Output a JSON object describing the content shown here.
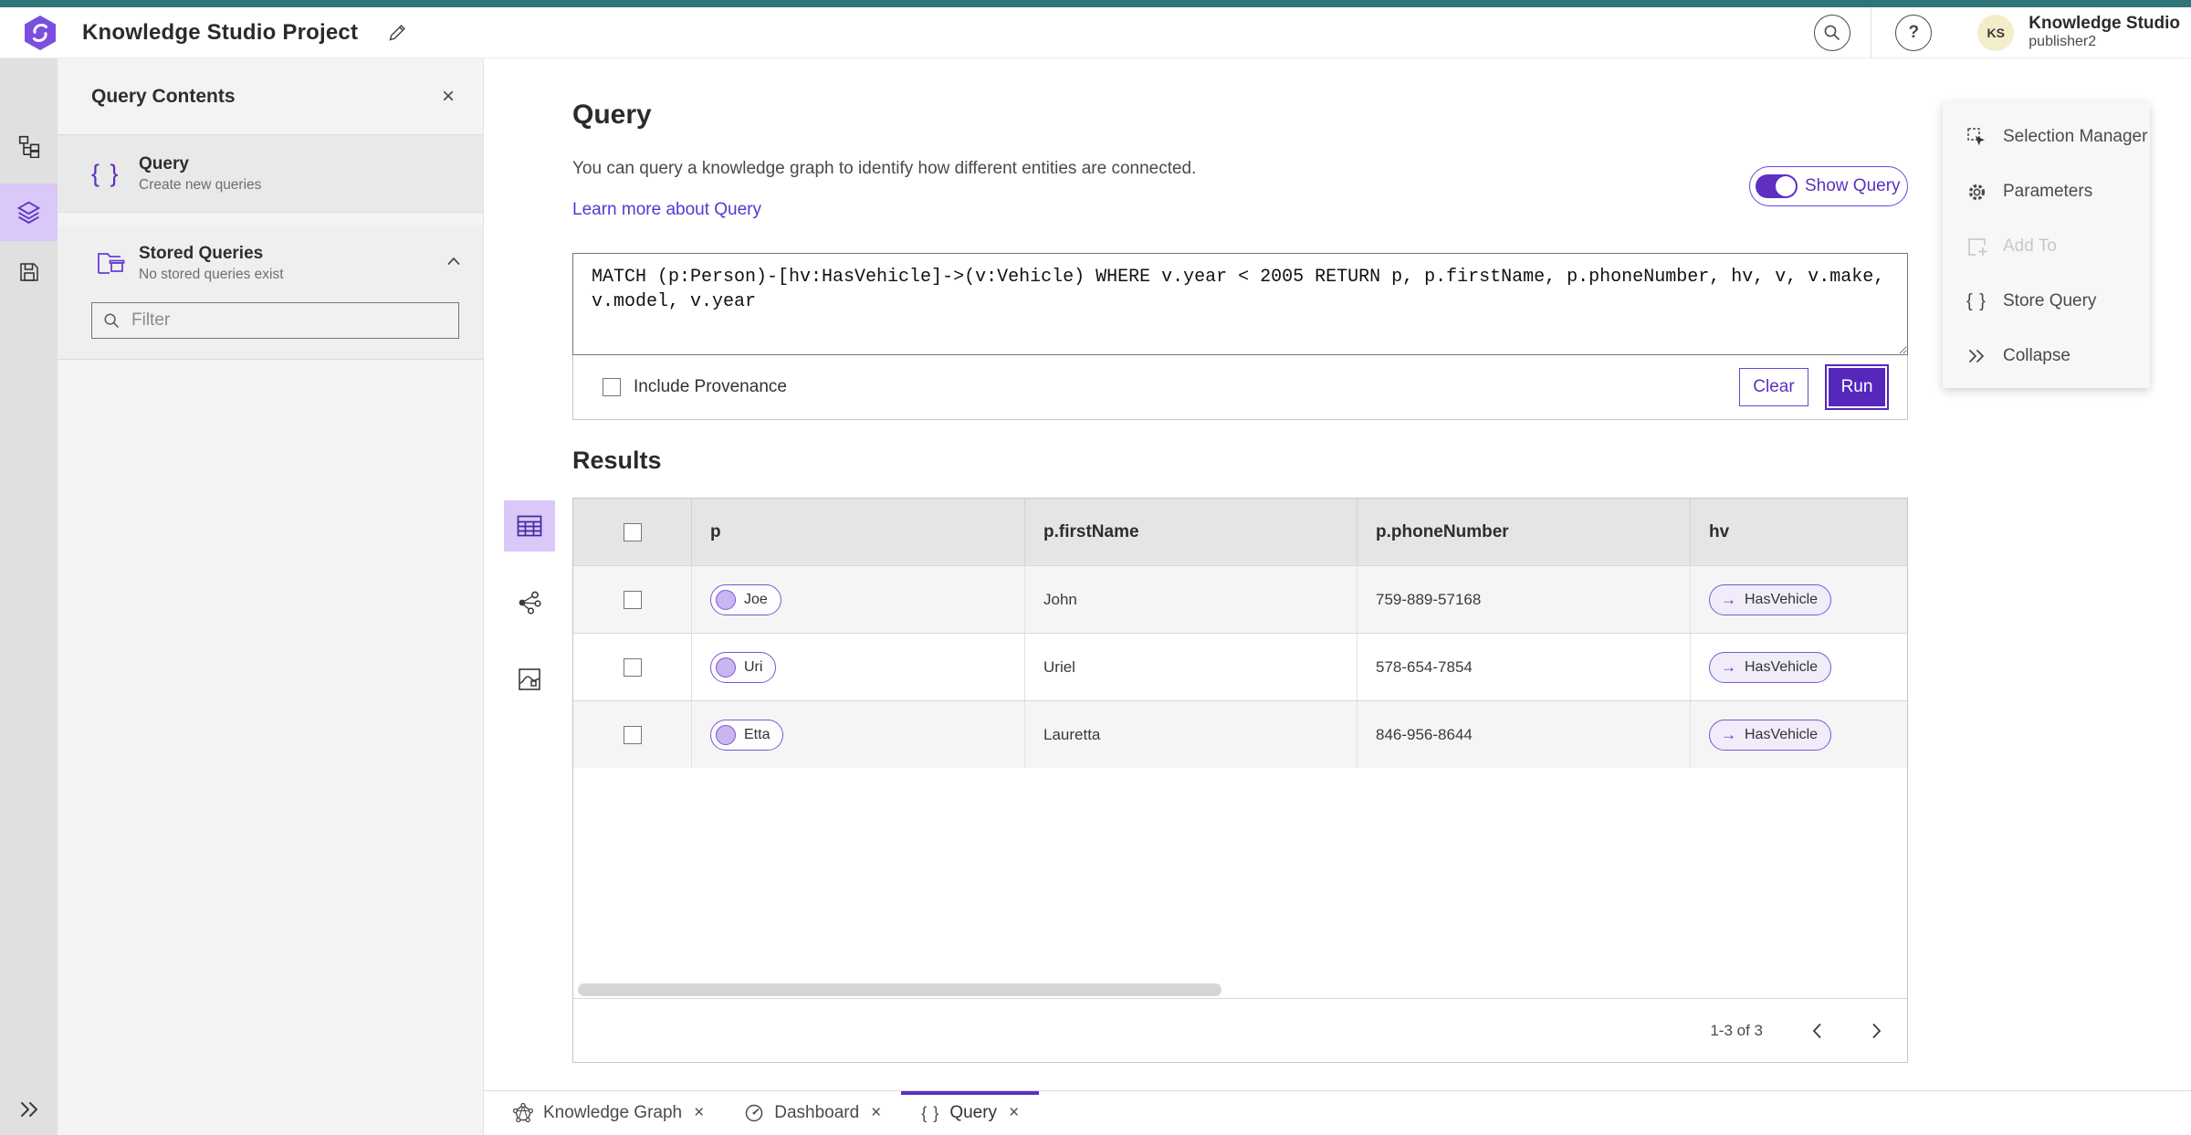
{
  "topbar": {
    "title": "Knowledge Studio Project",
    "user_name": "Knowledge Studio",
    "user_role": "publisher2",
    "avatar_initials": "KS",
    "help_glyph": "?"
  },
  "sidebar_panel": {
    "title": "Query Contents",
    "close_glyph": "×",
    "query_item": {
      "icon_glyph": "{ }",
      "title": "Query",
      "subtitle": "Create new queries"
    },
    "stored_queries": {
      "title": "Stored Queries",
      "subtitle": "No stored queries exist"
    },
    "filter": {
      "placeholder": "Filter"
    }
  },
  "query_section": {
    "heading": "Query",
    "description": "You can query a knowledge graph to identify how different entities are connected.",
    "learn_more_link": "Learn more about Query",
    "show_query_label": "Show Query",
    "query_text": "MATCH (p:Person)-[hv:HasVehicle]->(v:Vehicle) WHERE v.year < 2005 RETURN p, p.firstName, p.phoneNumber, hv, v, v.make, v.model, v.year",
    "include_provenance_label": "Include Provenance",
    "include_provenance_checked": false,
    "clear_label": "Clear",
    "run_label": "Run"
  },
  "results_section": {
    "heading": "Results",
    "columns": [
      "p",
      "p.firstName",
      "p.phoneNumber",
      "hv"
    ],
    "hv_arrow_glyph": "→",
    "rows": [
      {
        "p": "Joe",
        "firstName": "John",
        "phoneNumber": "759-889-57168",
        "hv": "HasVehicle"
      },
      {
        "p": "Uri",
        "firstName": "Uriel",
        "phoneNumber": "578-654-7854",
        "hv": "HasVehicle"
      },
      {
        "p": "Etta",
        "firstName": "Lauretta",
        "phoneNumber": "846-956-8644",
        "hv": "HasVehicle"
      }
    ],
    "pagination": {
      "range_label": "1-3 of 3"
    }
  },
  "actions_panel": {
    "items": [
      {
        "label": "Selection Manager",
        "disabled": false
      },
      {
        "label": "Parameters",
        "disabled": false
      },
      {
        "label": "Add To",
        "disabled": true
      },
      {
        "label": "Store Query",
        "disabled": false
      },
      {
        "label": "Collapse",
        "disabled": false
      }
    ],
    "store_query_glyph": "{ }"
  },
  "bottom_tabs": [
    {
      "label": "Knowledge Graph",
      "active": false
    },
    {
      "label": "Dashboard",
      "active": false
    },
    {
      "label": "Query",
      "active": true,
      "icon_glyph": "{ }"
    }
  ],
  "colors": {
    "teal_strip": "#2f7577",
    "accent_purple": "#5e2fc1",
    "accent_purple_dark": "#5527bd",
    "accent_light_bg": "#d9c8f8",
    "link": "#4d3bd3",
    "avatar_bg": "#f3edca"
  }
}
